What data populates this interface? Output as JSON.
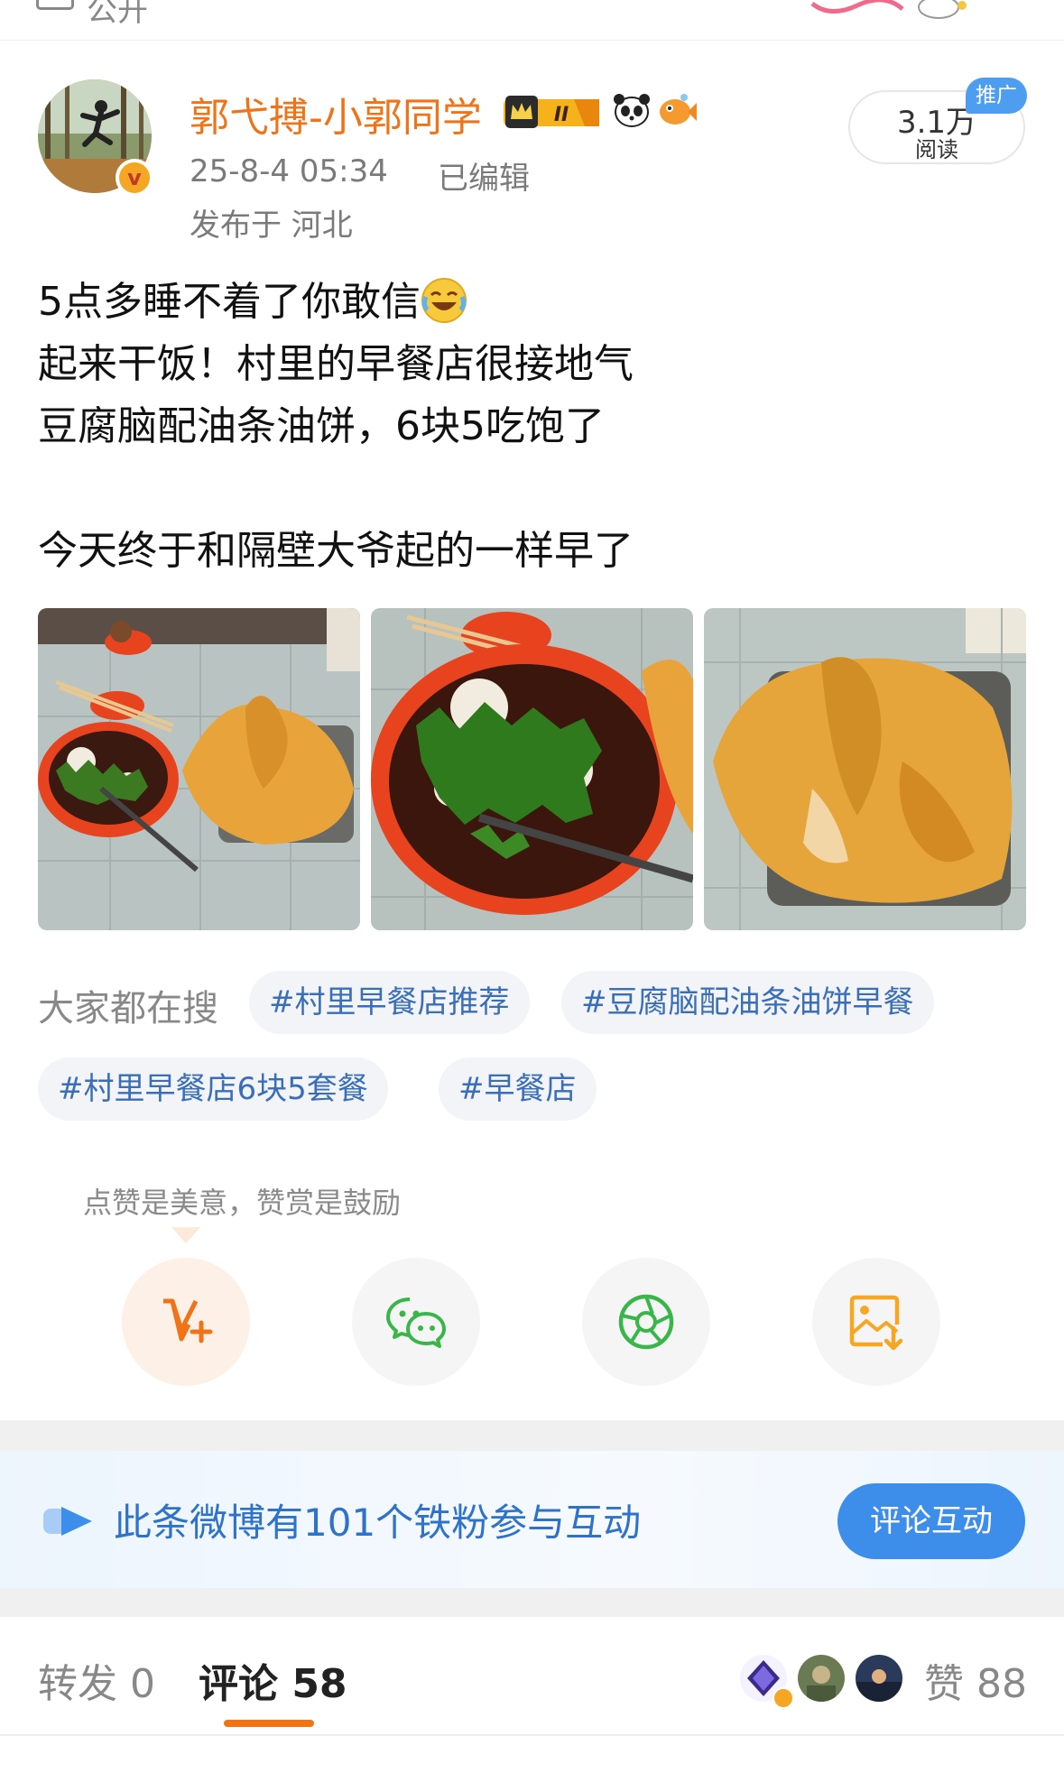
{
  "top_bar": {
    "visibility_label": "公开"
  },
  "author": {
    "name": "郭弋搏-小郭同学",
    "vip_level": "II",
    "timestamp": "25-8-4 05:34",
    "edited_label": "已编辑",
    "location": "发布于 河北"
  },
  "stats": {
    "reads_value": "3.1万",
    "reads_label": "阅读",
    "promo_tag": "推广"
  },
  "post": {
    "lines": [
      "5点多睡不着了你敢信",
      "起来干饭！村里的早餐店很接地气",
      "豆腐脑配油条油饼，6块5吃饱了",
      "今天终于和隔壁大爷起的一样早了"
    ],
    "emoji_icon": "laugh-cry-icon"
  },
  "trending": {
    "label": "大家都在搜",
    "tags": [
      "#村里早餐店推荐",
      "#豆腐脑配油条油饼早餐",
      "#村里早餐店6块5套餐",
      "#早餐店"
    ]
  },
  "share": {
    "tip": "点赞是美意，赞赏是鼓励",
    "icons": [
      "v-plus-icon",
      "wechat-icon",
      "moments-icon",
      "save-image-icon"
    ]
  },
  "banner": {
    "text": "此条微博有101个铁粉参与互动",
    "button": "评论互动"
  },
  "tabs": {
    "repost": "转发 0",
    "comment": "评论 58",
    "like": "赞 88"
  },
  "colors": {
    "brand_orange": "#f07318",
    "link_blue": "#3a6eb8",
    "banner_blue": "#2e73c9",
    "button_blue": "#3d8eea"
  }
}
